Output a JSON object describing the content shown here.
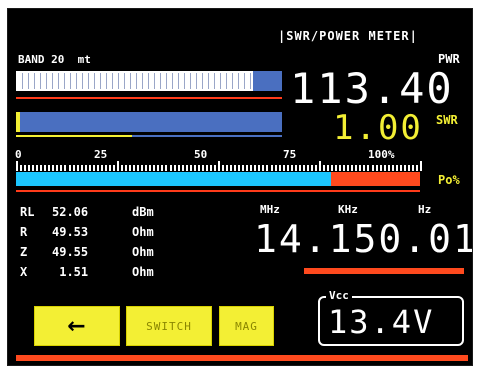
{
  "header": {
    "title": "|SWR/POWER METER|"
  },
  "band": {
    "label": "BAND 20  mt"
  },
  "power": {
    "value": "113.40",
    "label": "PWR",
    "fraction": 0.89
  },
  "swr": {
    "value": "1.00",
    "label": "SWR",
    "fraction": 0.015
  },
  "scale": {
    "ticks": [
      "0",
      "25",
      "50",
      "75",
      "100%"
    ]
  },
  "po": {
    "label": "Po%",
    "fraction": 0.78
  },
  "readings": [
    {
      "name": "RL",
      "value": "52.06",
      "unit": "dBm"
    },
    {
      "name": "R",
      "value": "49.53",
      "unit": "Ohm"
    },
    {
      "name": "Z",
      "value": "49.55",
      "unit": "Ohm"
    },
    {
      "name": "X",
      "value": " 1.51",
      "unit": "Ohm"
    }
  ],
  "frequency": {
    "mhz_label": "MHz",
    "khz_label": "KHz",
    "hz_label": "Hz",
    "value": "14.150.01"
  },
  "buttons": {
    "back_icon": "left-arrow-icon",
    "back_glyph": "←",
    "switch_label": "SWITCH",
    "mag_label": "MAG"
  },
  "vcc": {
    "label": "Vcc",
    "value": "13.4V"
  },
  "colors": {
    "bar_white": "#f2f2f2",
    "bar_blue": "#4a6fc0",
    "bar_cyan": "#1cc6ff",
    "bar_red": "#ff3b1a",
    "accent_yellow": "#f3ef34",
    "line_red": "#ff3b1a"
  }
}
